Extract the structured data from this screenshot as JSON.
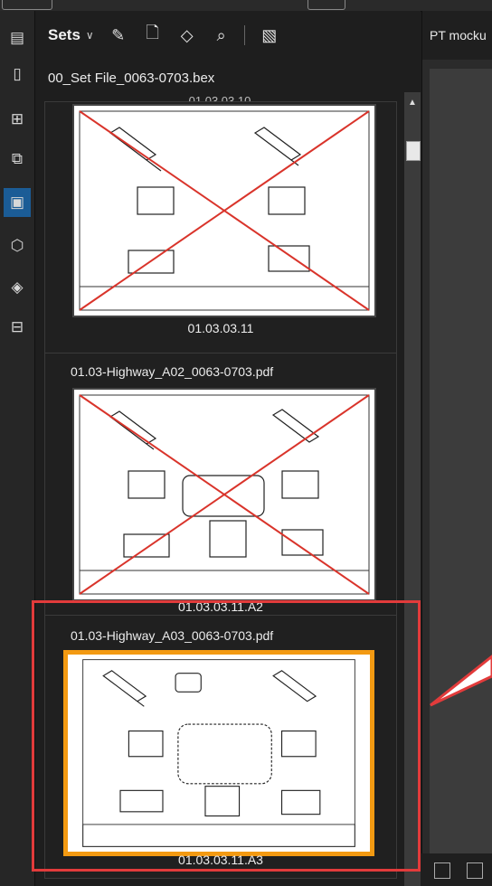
{
  "toolbar_icons": {
    "left": [
      "document-icon",
      "book-icon",
      "grid-icon",
      "markup-icon",
      "sets-icon",
      "cube-icon",
      "layers-icon",
      "toolbox-icon"
    ],
    "header": [
      "edit-set-icon",
      "add-file-icon",
      "tag-icon",
      "search-set-icon",
      "compare-icon"
    ]
  },
  "panel": {
    "title": "Sets",
    "file_name": "00_Set File_0063-0703.bex",
    "cropped_top_label": "01.03.03.10"
  },
  "cards": [
    {
      "title": "",
      "label": "01.03.03.11",
      "crossed": true,
      "selected": false
    },
    {
      "title": "01.03-Highway_A02_0063-0703.pdf",
      "label": "01.03.03.11.A2",
      "crossed": true,
      "selected": false
    },
    {
      "title": "01.03-Highway_A03_0063-0703.pdf",
      "label": "01.03.03.11.A3",
      "crossed": false,
      "selected": true
    }
  ],
  "viewer": {
    "tab_title": "PT mocku"
  },
  "colors": {
    "accent": "#1b5c96",
    "selected_border": "#f39a12",
    "highlight": "#e23b3b",
    "cross": "#d9342b"
  }
}
